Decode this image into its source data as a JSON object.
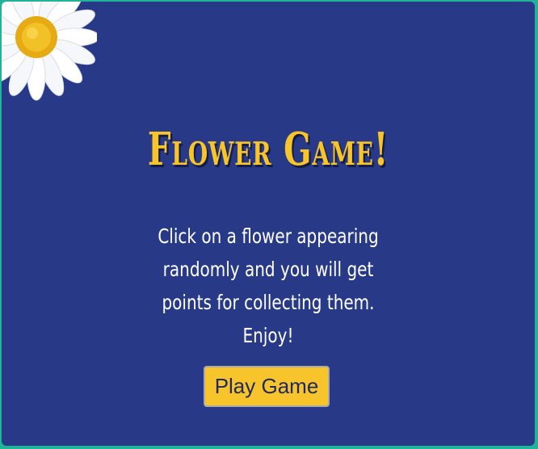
{
  "title": "Flower Game!",
  "description": "Click on a flower appearing randomly and you will get points for collecting them. Enjoy!",
  "play_button": "Play Game",
  "decoration": "daisy-flower-image",
  "colors": {
    "background": "#283a87",
    "accent": "#f7c42c",
    "border": "#1fb39a",
    "text": "#ffffff"
  }
}
